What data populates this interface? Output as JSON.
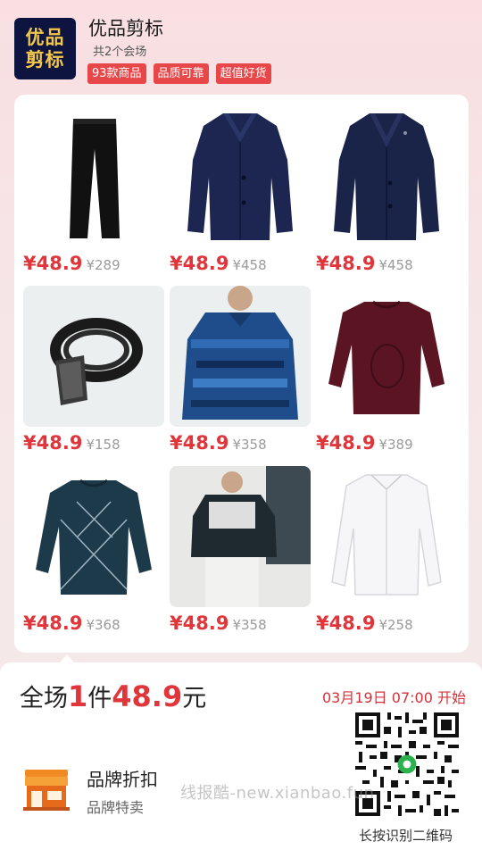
{
  "header": {
    "logo_line1": "优品",
    "logo_line2": "剪标",
    "shop_name": "优品剪标",
    "shop_sub": "共2个会场",
    "tags": [
      "93款商品",
      "品质可靠",
      "超值好货"
    ]
  },
  "products": [
    {
      "name": "trousers",
      "price": "¥48.9",
      "orig": "¥289"
    },
    {
      "name": "navy-coat",
      "price": "¥48.9",
      "orig": "¥458"
    },
    {
      "name": "navy-coat-2",
      "price": "¥48.9",
      "orig": "¥458"
    },
    {
      "name": "belt",
      "price": "¥48.9",
      "orig": "¥158"
    },
    {
      "name": "blue-shirt",
      "price": "¥48.9",
      "orig": "¥358"
    },
    {
      "name": "burgundy-sweater",
      "price": "¥48.9",
      "orig": "¥389"
    },
    {
      "name": "teal-sweater",
      "price": "¥48.9",
      "orig": "¥368"
    },
    {
      "name": "improve-sweatshirt",
      "price": "¥48.9",
      "orig": "¥358"
    },
    {
      "name": "white-shirt",
      "price": "¥48.9",
      "orig": "¥258"
    }
  ],
  "promo": {
    "part1": "全场",
    "part2": "1",
    "part3": "件",
    "part4": "48.9",
    "part5": "元",
    "start_time": "03月19日 07:00 开始"
  },
  "brand": {
    "title": "品牌折扣",
    "subtitle": "品牌特卖"
  },
  "qr_label": "长按识别二维码",
  "watermark": "线报酷-new.xianbao.fun",
  "colors": {
    "accent": "#e0353a",
    "logo_bg": "#0e1440",
    "logo_text": "#f3c84a"
  }
}
